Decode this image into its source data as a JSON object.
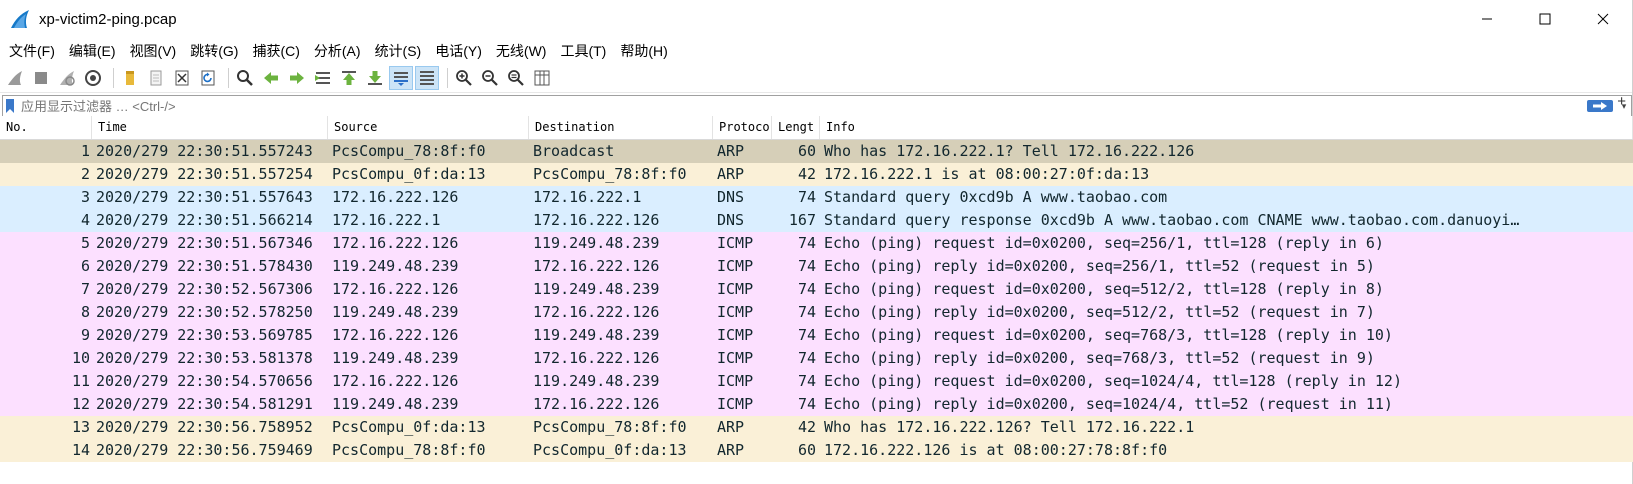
{
  "window": {
    "title": "xp-victim2-ping.pcap"
  },
  "menu": [
    "文件(F)",
    "编辑(E)",
    "视图(V)",
    "跳转(G)",
    "捕获(C)",
    "分析(A)",
    "统计(S)",
    "电话(Y)",
    "无线(W)",
    "工具(T)",
    "帮助(H)"
  ],
  "filter": {
    "placeholder": "应用显示过滤器 … <Ctrl-/>",
    "plus": "+"
  },
  "columns": [
    "No.",
    "Time",
    "Source",
    "Destination",
    "Protocol",
    "Length",
    "Info"
  ],
  "columns_visible": [
    "No.",
    "Time",
    "Source",
    "Destination",
    "Protoco",
    "Lengt",
    "Info"
  ],
  "row_colors": {
    "ARP": "#faf0d7",
    "DNS": "#daeeff",
    "ICMP": "#fce0ff",
    "selected_arp": "#d6cfb8"
  },
  "packets": [
    {
      "no": "1",
      "time": "2020/279 22:30:51.557243",
      "src": "PcsCompu_78:8f:f0",
      "dst": "Broadcast",
      "proto": "ARP",
      "len": "60",
      "info": "Who has 172.16.222.1? Tell 172.16.222.126"
    },
    {
      "no": "2",
      "time": "2020/279 22:30:51.557254",
      "src": "PcsCompu_0f:da:13",
      "dst": "PcsCompu_78:8f:f0",
      "proto": "ARP",
      "len": "42",
      "info": "172.16.222.1 is at 08:00:27:0f:da:13"
    },
    {
      "no": "3",
      "time": "2020/279 22:30:51.557643",
      "src": "172.16.222.126",
      "dst": "172.16.222.1",
      "proto": "DNS",
      "len": "74",
      "info": "Standard query 0xcd9b A www.taobao.com"
    },
    {
      "no": "4",
      "time": "2020/279 22:30:51.566214",
      "src": "172.16.222.1",
      "dst": "172.16.222.126",
      "proto": "DNS",
      "len": "167",
      "info": "Standard query response 0xcd9b A www.taobao.com CNAME www.taobao.com.danuoyi…"
    },
    {
      "no": "5",
      "time": "2020/279 22:30:51.567346",
      "src": "172.16.222.126",
      "dst": "119.249.48.239",
      "proto": "ICMP",
      "len": "74",
      "info": "Echo (ping) request  id=0x0200, seq=256/1, ttl=128 (reply in 6)"
    },
    {
      "no": "6",
      "time": "2020/279 22:30:51.578430",
      "src": "119.249.48.239",
      "dst": "172.16.222.126",
      "proto": "ICMP",
      "len": "74",
      "info": "Echo (ping) reply    id=0x0200, seq=256/1, ttl=52 (request in 5)"
    },
    {
      "no": "7",
      "time": "2020/279 22:30:52.567306",
      "src": "172.16.222.126",
      "dst": "119.249.48.239",
      "proto": "ICMP",
      "len": "74",
      "info": "Echo (ping) request  id=0x0200, seq=512/2, ttl=128 (reply in 8)"
    },
    {
      "no": "8",
      "time": "2020/279 22:30:52.578250",
      "src": "119.249.48.239",
      "dst": "172.16.222.126",
      "proto": "ICMP",
      "len": "74",
      "info": "Echo (ping) reply    id=0x0200, seq=512/2, ttl=52 (request in 7)"
    },
    {
      "no": "9",
      "time": "2020/279 22:30:53.569785",
      "src": "172.16.222.126",
      "dst": "119.249.48.239",
      "proto": "ICMP",
      "len": "74",
      "info": "Echo (ping) request  id=0x0200, seq=768/3, ttl=128 (reply in 10)"
    },
    {
      "no": "10",
      "time": "2020/279 22:30:53.581378",
      "src": "119.249.48.239",
      "dst": "172.16.222.126",
      "proto": "ICMP",
      "len": "74",
      "info": "Echo (ping) reply    id=0x0200, seq=768/3, ttl=52 (request in 9)"
    },
    {
      "no": "11",
      "time": "2020/279 22:30:54.570656",
      "src": "172.16.222.126",
      "dst": "119.249.48.239",
      "proto": "ICMP",
      "len": "74",
      "info": "Echo (ping) request  id=0x0200, seq=1024/4, ttl=128 (reply in 12)"
    },
    {
      "no": "12",
      "time": "2020/279 22:30:54.581291",
      "src": "119.249.48.239",
      "dst": "172.16.222.126",
      "proto": "ICMP",
      "len": "74",
      "info": "Echo (ping) reply    id=0x0200, seq=1024/4, ttl=52 (request in 11)"
    },
    {
      "no": "13",
      "time": "2020/279 22:30:56.758952",
      "src": "PcsCompu_0f:da:13",
      "dst": "PcsCompu_78:8f:f0",
      "proto": "ARP",
      "len": "42",
      "info": "Who has 172.16.222.126? Tell 172.16.222.1"
    },
    {
      "no": "14",
      "time": "2020/279 22:30:56.759469",
      "src": "PcsCompu_78:8f:f0",
      "dst": "PcsCompu_0f:da:13",
      "proto": "ARP",
      "len": "60",
      "info": "172.16.222.126 is at 08:00:27:78:8f:f0"
    }
  ]
}
